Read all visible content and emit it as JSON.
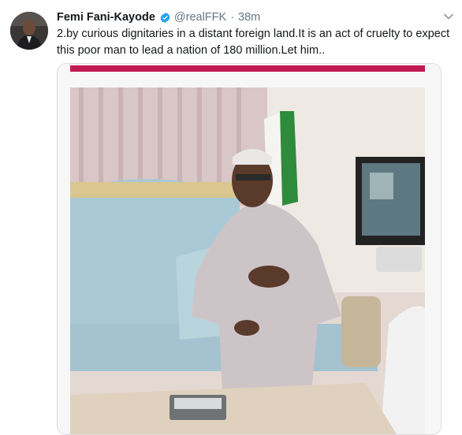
{
  "tweet": {
    "author_name": "Femi Fani-Kayode",
    "handle": "@realFFK",
    "separator": "·",
    "time": "38m",
    "text": "2.by curious dignitaries in a distant foreign land.It is an act of cruelty to expect this poor man to lead a nation of 180 million.Let him..",
    "verified": true
  },
  "icons": {
    "verified": "verified-badge-icon",
    "menu": "chevron-down-icon"
  },
  "colors": {
    "name": "#14171a",
    "secondary": "#657786",
    "verified": "#1da1f2"
  }
}
